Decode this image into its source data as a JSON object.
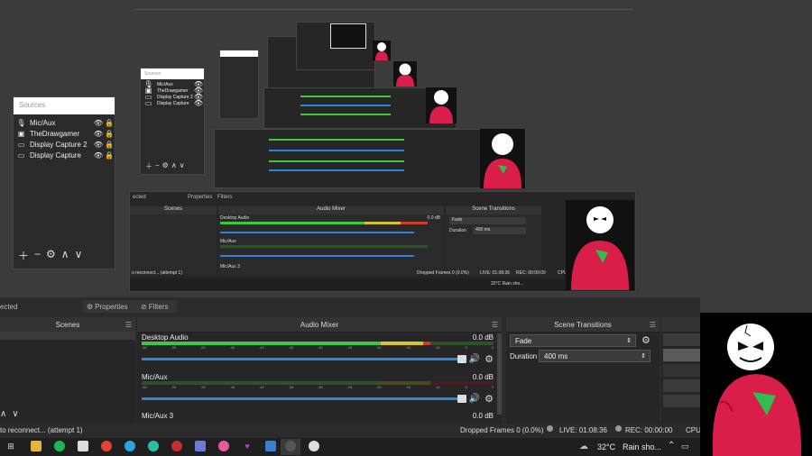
{
  "sources_panel": {
    "title": "Sources",
    "items": [
      {
        "label": "Mic/Aux",
        "icon": "microphone-icon"
      },
      {
        "label": "TheDrawgamer",
        "icon": "image-icon"
      },
      {
        "label": "Display Capture 2",
        "icon": "monitor-icon"
      },
      {
        "label": "Display Capture",
        "icon": "monitor-icon"
      }
    ]
  },
  "nested_small": {
    "title": "Sources",
    "items": [
      "Mic/Aux",
      "TheDrawgamer",
      "Display Capture 2",
      "Display Capture"
    ]
  },
  "nested_mid": {
    "tabs": {
      "selected": "ected",
      "properties": "Properties",
      "filters": "Filters"
    },
    "scenes": "Scenes",
    "audio_mixer": "Audio Mixer",
    "scene_transitions": "Scene Transitions",
    "desktop_audio": "Desktop Audio",
    "mic_aux": "Mic/Aux",
    "mic_aux3": "Mic/Aux 3",
    "db": "0.0 dB",
    "fade": "Fade",
    "duration_label": "Duration",
    "duration_value": "400 ms",
    "status": "o reconnect... (attempt 1)",
    "dropped": "Dropped Frames 0 (0.0%)",
    "live": "LIVE: 01:08:36",
    "rec": "REC: 00:00:00",
    "cpu": "CPU",
    "weather": "32°C  Rain sho..."
  },
  "tabs": {
    "selected_label": "ected",
    "properties_label": "Properties",
    "filters_label": "Filters"
  },
  "scenes": {
    "title": "Scenes"
  },
  "audio_mixer": {
    "title": "Audio Mixer",
    "channels": [
      {
        "name": "Desktop Audio",
        "db": "0.0 dB",
        "level": 0.78
      },
      {
        "name": "Mic/Aux",
        "db": "0.0 dB",
        "level": 0.0
      },
      {
        "name": "Mic/Aux 3",
        "db": "0.0 dB",
        "level": 0.0
      }
    ],
    "ticks": [
      "-60",
      "-55",
      "-50",
      "-45",
      "-40",
      "-35",
      "-30",
      "-25",
      "-20",
      "-15",
      "-10",
      "-5",
      "0"
    ]
  },
  "scene_transitions": {
    "title": "Scene Transitions",
    "transition": "Fade",
    "duration_label": "Duration",
    "duration_value": "400 ms"
  },
  "status_bar": {
    "reconnect": "to reconnect... (attempt 1)",
    "dropped_frames": "Dropped Frames 0 (0.0%)",
    "live": "LIVE: 01:08:36",
    "rec": "REC: 00:00:00",
    "cpu": "CPU:"
  },
  "taskbar": {
    "weather": "32°C",
    "weather_desc": "Rain sho...",
    "apps": [
      "task-view-icon",
      "file-explorer-icon",
      "spotify-icon",
      "calculator-icon",
      "chrome-icon",
      "telegram-icon",
      "edge-icon",
      "obs-icon",
      "paint-icon",
      "heart-app-icon",
      "media-icon",
      "obs-studio-icon",
      "game-icon"
    ]
  },
  "colors": {
    "meter_green": "#3fc73f",
    "meter_yellow": "#d6c52a",
    "meter_red": "#d23a2a",
    "volume_blue": "#2f82d8",
    "avatar_red": "#d91e4a",
    "panel_bg": "#262626"
  }
}
